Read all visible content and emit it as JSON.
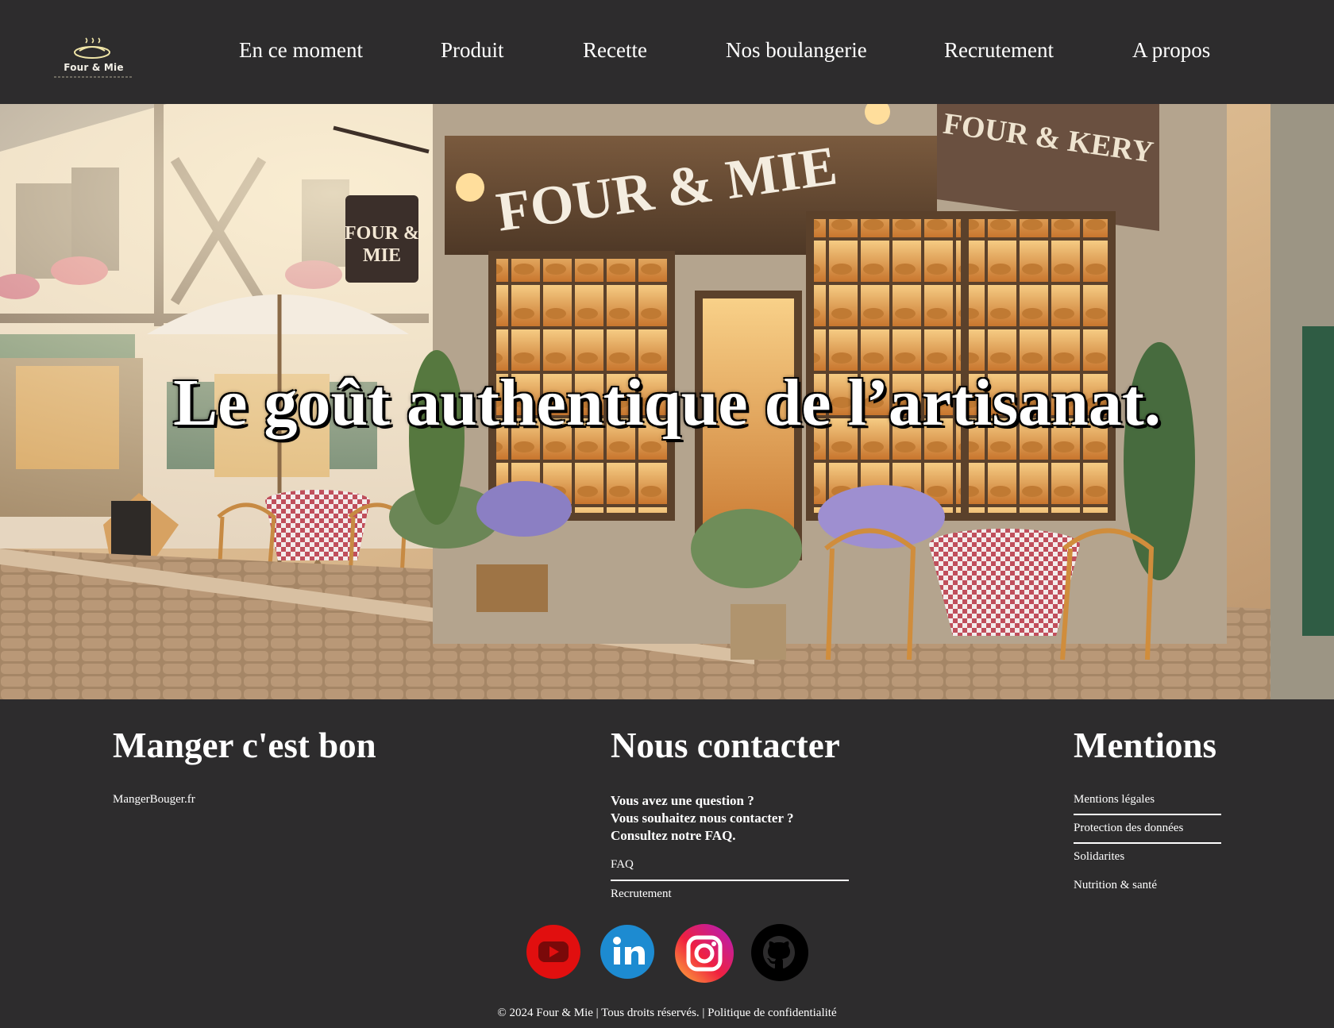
{
  "header": {
    "logo_text": "Four & Mie",
    "nav": [
      {
        "label": "En ce moment"
      },
      {
        "label": "Produit"
      },
      {
        "label": "Recette"
      },
      {
        "label": "Nos boulangerie"
      },
      {
        "label": "Recrutement"
      },
      {
        "label": "A propos"
      }
    ]
  },
  "hero": {
    "title": "Le goût authentique de l’artisanat.",
    "sign_main": "FOUR & MIE",
    "sign_side": "FOUR & KERY",
    "sign_hanging_1": "FOUR &",
    "sign_hanging_2": "MIE"
  },
  "footer": {
    "col1": {
      "title": "Manger c'est bon",
      "link": "MangerBouger.fr"
    },
    "col2": {
      "title": "Nous contacter",
      "lines": [
        "Vous avez une question ?",
        "Vous souhaitez nous contacter ?",
        "Consultez notre FAQ."
      ],
      "links": [
        "FAQ",
        "Recrutement"
      ]
    },
    "col3": {
      "title": "Mentions",
      "links": [
        "Mentions légales",
        "Protection des données",
        "Solidarites",
        "Nutrition & santé"
      ]
    },
    "social": [
      "youtube-icon",
      "linkedin-icon",
      "instagram-icon",
      "github-icon"
    ],
    "copyright": "© 2024 Four & Mie | Tous droits réservés. | Politique de confidentialité"
  },
  "colors": {
    "background": "#2d2c2d",
    "text": "#ffffff",
    "youtube": "#e10f0f",
    "linkedin": "#1d8bd1",
    "github": "#000000"
  }
}
